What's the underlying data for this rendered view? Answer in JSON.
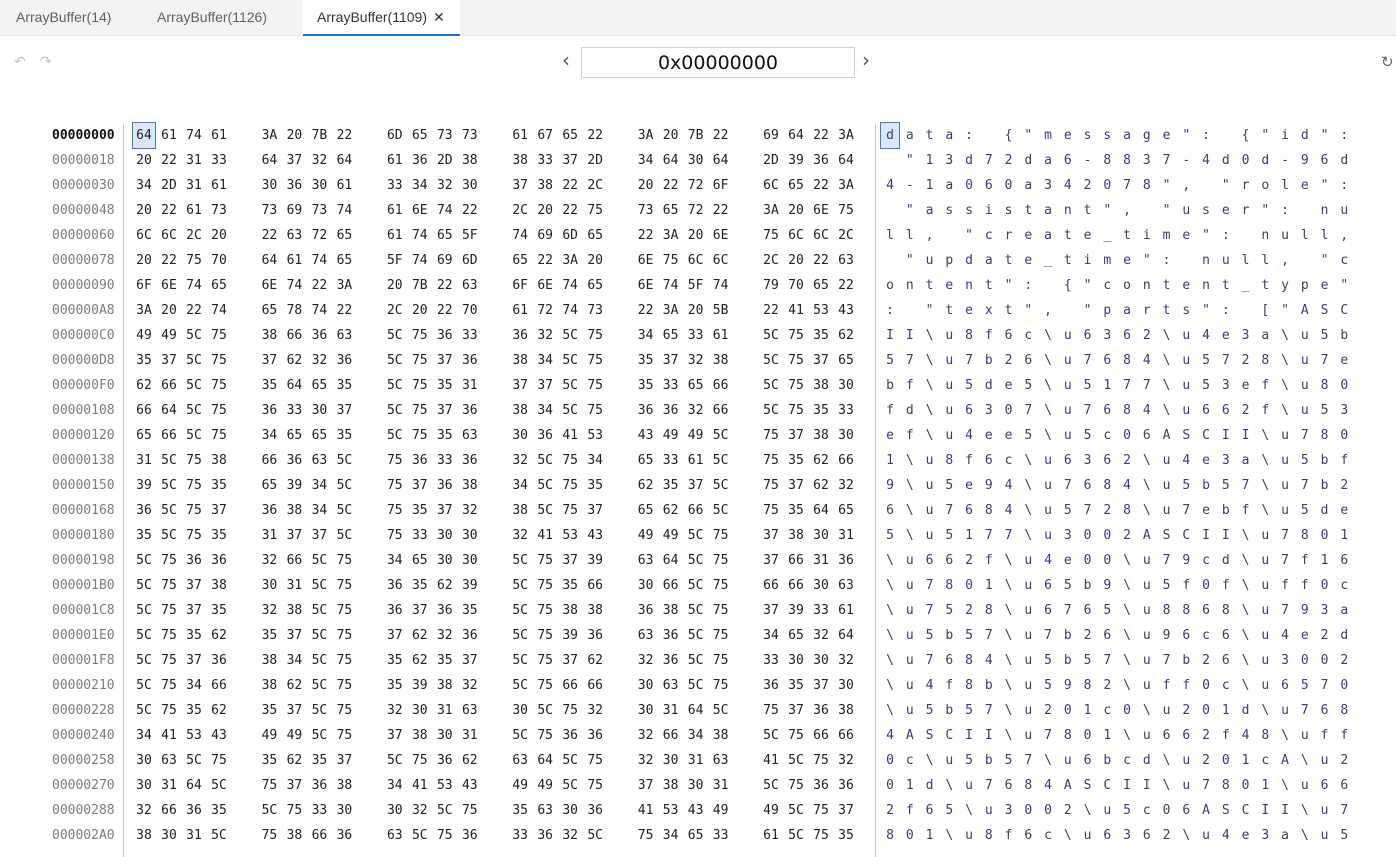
{
  "tabs": [
    {
      "label": "ArrayBuffer(14)",
      "active": false
    },
    {
      "label": "ArrayBuffer(1126)",
      "active": false
    },
    {
      "label": "ArrayBuffer(1109)",
      "active": true
    }
  ],
  "close_glyph": "✕",
  "toolbar": {
    "undo_icon": "undo-icon",
    "redo_icon": "redo-icon",
    "prev_glyph": "‹",
    "next_glyph": "›",
    "refresh_icon": "refresh-icon",
    "address_value": "0x00000000"
  },
  "rows": [
    {
      "offset": "00000000",
      "hex": "64 61 74 61 3A 20 7B 22 6D 65 73 73 61 67 65 22 3A 20 7B 22 69 64 22 3A",
      "ascii": "data: {\"message\": {\"id\":"
    },
    {
      "offset": "00000018",
      "hex": "20 22 31 33 64 37 32 64 61 36 2D 38 38 33 37 2D 34 64 30 64 2D 39 36 64",
      "ascii": " \"13d72da6-8837-4d0d-96d"
    },
    {
      "offset": "00000030",
      "hex": "34 2D 31 61 30 36 30 61 33 34 32 30 37 38 22 2C 20 22 72 6F 6C 65 22 3A",
      "ascii": "4-1a060a342078\", \"role\":"
    },
    {
      "offset": "00000048",
      "hex": "20 22 61 73 73 69 73 74 61 6E 74 22 2C 20 22 75 73 65 72 22 3A 20 6E 75",
      "ascii": " \"assistant\", \"user\": nu"
    },
    {
      "offset": "00000060",
      "hex": "6C 6C 2C 20 22 63 72 65 61 74 65 5F 74 69 6D 65 22 3A 20 6E 75 6C 6C 2C",
      "ascii": "ll, \"create_time\": null,"
    },
    {
      "offset": "00000078",
      "hex": "20 22 75 70 64 61 74 65 5F 74 69 6D 65 22 3A 20 6E 75 6C 6C 2C 20 22 63",
      "ascii": " \"update_time\": null, \"c"
    },
    {
      "offset": "00000090",
      "hex": "6F 6E 74 65 6E 74 22 3A 20 7B 22 63 6F 6E 74 65 6E 74 5F 74 79 70 65 22",
      "ascii": "ontent\": {\"content_type\""
    },
    {
      "offset": "000000A8",
      "hex": "3A 20 22 74 65 78 74 22 2C 20 22 70 61 72 74 73 22 3A 20 5B 22 41 53 43",
      "ascii": ": \"text\", \"parts\": [\"ASC"
    },
    {
      "offset": "000000C0",
      "hex": "49 49 5C 75 38 66 36 63 5C 75 36 33 36 32 5C 75 34 65 33 61 5C 75 35 62",
      "ascii": "II\\u8f6c\\u6362\\u4e3a\\u5b"
    },
    {
      "offset": "000000D8",
      "hex": "35 37 5C 75 37 62 32 36 5C 75 37 36 38 34 5C 75 35 37 32 38 5C 75 37 65",
      "ascii": "57\\u7b26\\u7684\\u5728\\u7e"
    },
    {
      "offset": "000000F0",
      "hex": "62 66 5C 75 35 64 65 35 5C 75 35 31 37 37 5C 75 35 33 65 66 5C 75 38 30",
      "ascii": "bf\\u5de5\\u5177\\u53ef\\u80"
    },
    {
      "offset": "00000108",
      "hex": "66 64 5C 75 36 33 30 37 5C 75 37 36 38 34 5C 75 36 36 32 66 5C 75 35 33",
      "ascii": "fd\\u6307\\u7684\\u662f\\u53"
    },
    {
      "offset": "00000120",
      "hex": "65 66 5C 75 34 65 65 35 5C 75 35 63 30 36 41 53 43 49 49 5C 75 37 38 30",
      "ascii": "ef\\u4ee5\\u5c06ASCII\\u780"
    },
    {
      "offset": "00000138",
      "hex": "31 5C 75 38 66 36 63 5C 75 36 33 36 32 5C 75 34 65 33 61 5C 75 35 62 66",
      "ascii": "1\\u8f6c\\u6362\\u4e3a\\u5bf"
    },
    {
      "offset": "00000150",
      "hex": "39 5C 75 35 65 39 34 5C 75 37 36 38 34 5C 75 35 62 35 37 5C 75 37 62 32",
      "ascii": "9\\u5e94\\u7684\\u5b57\\u7b2"
    },
    {
      "offset": "00000168",
      "hex": "36 5C 75 37 36 38 34 5C 75 35 37 32 38 5C 75 37 65 62 66 5C 75 35 64 65",
      "ascii": "6\\u7684\\u5728\\u7ebf\\u5de"
    },
    {
      "offset": "00000180",
      "hex": "35 5C 75 35 31 37 37 5C 75 33 30 30 32 41 53 43 49 49 5C 75 37 38 30 31",
      "ascii": "5\\u5177\\u3002ASCII\\u7801"
    },
    {
      "offset": "00000198",
      "hex": "5C 75 36 36 32 66 5C 75 34 65 30 30 5C 75 37 39 63 64 5C 75 37 66 31 36",
      "ascii": "\\u662f\\u4e00\\u79cd\\u7f16"
    },
    {
      "offset": "000001B0",
      "hex": "5C 75 37 38 30 31 5C 75 36 35 62 39 5C 75 35 66 30 66 5C 75 66 66 30 63",
      "ascii": "\\u7801\\u65b9\\u5f0f\\uff0c"
    },
    {
      "offset": "000001C8",
      "hex": "5C 75 37 35 32 38 5C 75 36 37 36 35 5C 75 38 38 36 38 5C 75 37 39 33 61",
      "ascii": "\\u7528\\u6765\\u8868\\u793a"
    },
    {
      "offset": "000001E0",
      "hex": "5C 75 35 62 35 37 5C 75 37 62 32 36 5C 75 39 36 63 36 5C 75 34 65 32 64",
      "ascii": "\\u5b57\\u7b26\\u96c6\\u4e2d"
    },
    {
      "offset": "000001F8",
      "hex": "5C 75 37 36 38 34 5C 75 35 62 35 37 5C 75 37 62 32 36 5C 75 33 30 30 32",
      "ascii": "\\u7684\\u5b57\\u7b26\\u3002"
    },
    {
      "offset": "00000210",
      "hex": "5C 75 34 66 38 62 5C 75 35 39 38 32 5C 75 66 66 30 63 5C 75 36 35 37 30",
      "ascii": "\\u4f8b\\u5982\\uff0c\\u6570"
    },
    {
      "offset": "00000228",
      "hex": "5C 75 35 62 35 37 5C 75 32 30 31 63 30 5C 75 32 30 31 64 5C 75 37 36 38",
      "ascii": "\\u5b57\\u201c0\\u201d\\u768"
    },
    {
      "offset": "00000240",
      "hex": "34 41 53 43 49 49 5C 75 37 38 30 31 5C 75 36 36 32 66 34 38 5C 75 66 66",
      "ascii": "4ASCII\\u7801\\u662f48\\uff"
    },
    {
      "offset": "00000258",
      "hex": "30 63 5C 75 35 62 35 37 5C 75 36 62 63 64 5C 75 32 30 31 63 41 5C 75 32",
      "ascii": "0c\\u5b57\\u6bcd\\u201cA\\u2"
    },
    {
      "offset": "00000270",
      "hex": "30 31 64 5C 75 37 36 38 34 41 53 43 49 49 5C 75 37 38 30 31 5C 75 36 36",
      "ascii": "01d\\u7684ASCII\\u7801\\u66"
    },
    {
      "offset": "00000288",
      "hex": "32 66 36 35 5C 75 33 30 30 32 5C 75 35 63 30 36 41 53 43 49 49 5C 75 37",
      "ascii": "2f65\\u3002\\u5c06ASCII\\u7"
    },
    {
      "offset": "000002A0",
      "hex": "38 30 31 5C 75 38 66 36 63 5C 75 36 33 36 32 5C 75 34 65 33 61 5C 75 35",
      "ascii": "801\\u8f6c\\u6362\\u4e3a\\u5"
    }
  ]
}
